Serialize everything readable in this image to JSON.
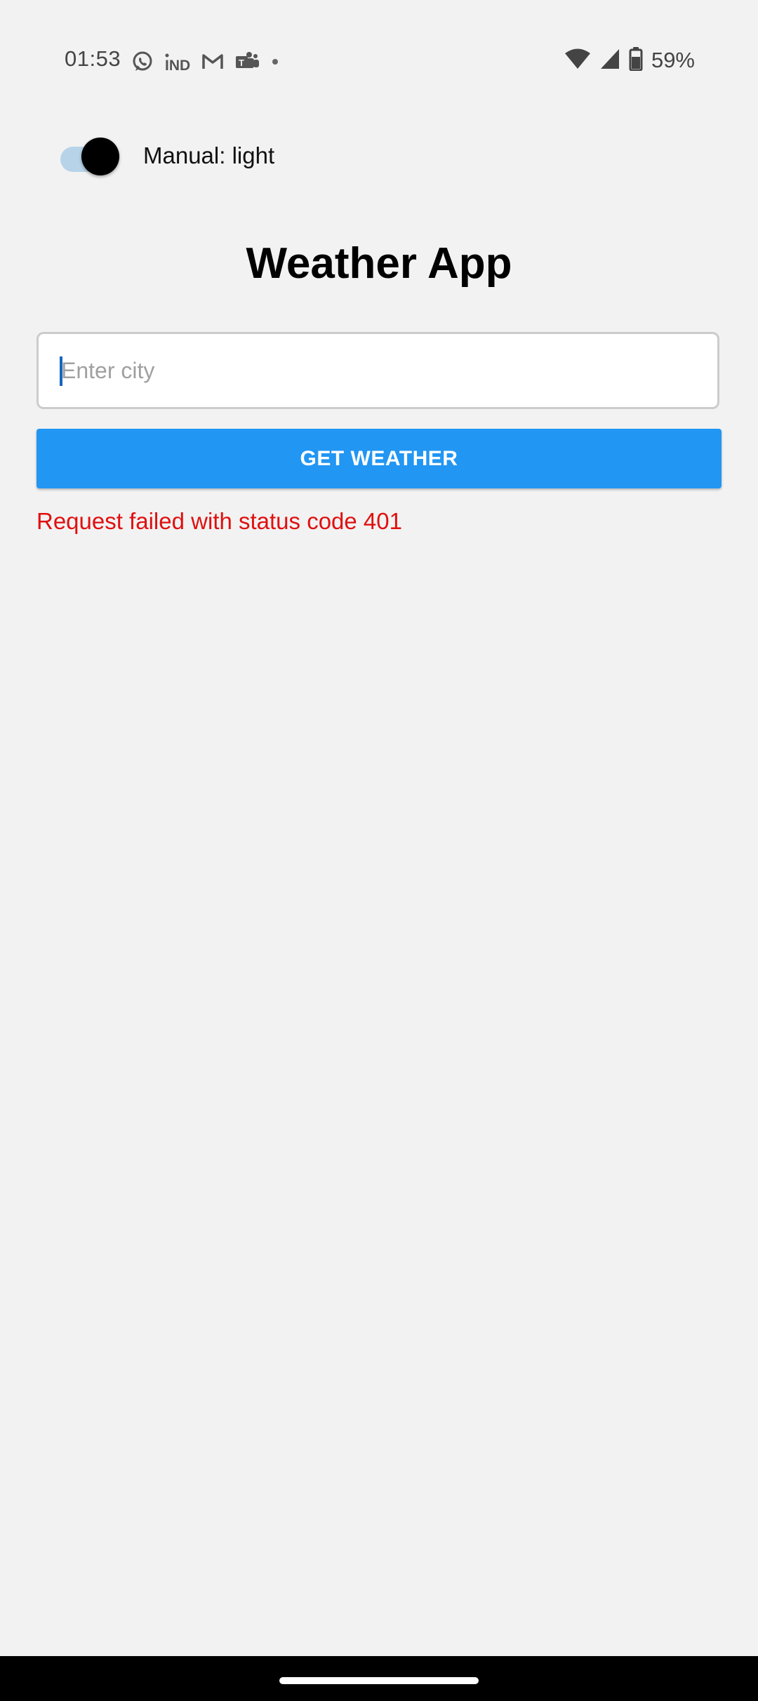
{
  "status_bar": {
    "time": "01:53",
    "battery_percent": "59%",
    "notification_icons": [
      "whatsapp-icon",
      "indeed-icon",
      "gmail-icon",
      "teams-icon",
      "more-dot-icon"
    ],
    "system_icons": [
      "wifi-icon",
      "cellular-signal-icon",
      "battery-icon"
    ]
  },
  "theme_toggle": {
    "label": "Manual: light",
    "on": true,
    "track_color": "#b7d3e8",
    "thumb_color": "#000000"
  },
  "header": {
    "title": "Weather App"
  },
  "search": {
    "placeholder": "Enter city",
    "value": ""
  },
  "actions": {
    "get_weather_label": "GET WEATHER",
    "button_color": "#2196f3"
  },
  "error": {
    "message": "Request failed with status code 401",
    "color": "#e01010"
  },
  "colors": {
    "background": "#f2f2f2"
  }
}
